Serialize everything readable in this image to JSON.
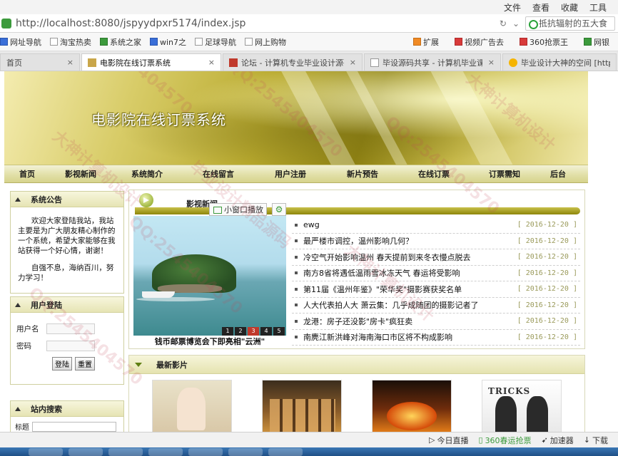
{
  "browser": {
    "menu": [
      "文件",
      "查看",
      "收藏",
      "工具"
    ],
    "url": "http://localhost:8080/jspyydpxr5174/index.jsp",
    "search_text": "抵抗辐射的五大食",
    "bookmarks": [
      "网址导航",
      "淘宝热卖",
      "系统之家",
      "win7之",
      "足球导航",
      "网上购物"
    ],
    "bookmarks_right": [
      "扩展",
      "视频广告去",
      "360抢票王",
      "网银"
    ],
    "tabs": [
      {
        "label": "首页",
        "active": false
      },
      {
        "label": "电影院在线订票系统",
        "active": true
      },
      {
        "label": "论坛 - 计算机专业毕业设计源码网",
        "active": false
      },
      {
        "label": "毕设源码共享 - 计算机毕业课程设计",
        "active": false
      },
      {
        "label": "毕业设计大神的空间 [http://",
        "active": false
      }
    ],
    "status": [
      "今日直播",
      "360春运抢票",
      "加速器",
      "下载"
    ]
  },
  "site": {
    "title": "电影院在线订票系统",
    "nav": [
      "首页",
      "影视新闻",
      "系统简介",
      "在线留言",
      "用户注册",
      "新片预告",
      "在线订票",
      "订票需知",
      "后台"
    ],
    "notice": {
      "heading": "系统公告",
      "para1": "欢迎大家登陆我站，我站主要是为广大朋友精心制作的一个系统，希望大家能够在我站获得一个好心情，谢谢！",
      "para2": "自强不息，海纳百川，努力学习！"
    },
    "login": {
      "heading": "用户登陆",
      "user_label": "用户名",
      "pass_label": "密码",
      "login_btn": "登陆",
      "reset_btn": "重置"
    },
    "search": {
      "heading": "站内搜索",
      "label": "标题"
    },
    "news": {
      "heading": "影视新闻",
      "popup_label": "小窗口播放",
      "photo_caption": "钱币邮票博览会下即亮相\"云洲\"",
      "pager": [
        "1",
        "2",
        "3",
        "4",
        "5"
      ],
      "active_page": "3",
      "items": [
        {
          "title": "ewg",
          "date": "[ 2016-12-20 ]"
        },
        {
          "title": "最严楼市调控，温州影响几何？",
          "date": "[ 2016-12-20 ]"
        },
        {
          "title": "冷空气开始影响温州 春天提前到来冬衣慢点脱去",
          "date": "[ 2016-12-20 ]"
        },
        {
          "title": "南方8省将遇低温雨雪冰冻天气 春运将受影响",
          "date": "[ 2016-12-20 ]"
        },
        {
          "title": "第11届《温州年鉴》\"荣华奖\"摄影赛获奖名单",
          "date": "[ 2016-12-20 ]"
        },
        {
          "title": "人大代表拍人大 萧云集：几乎成随团的摄影记者了",
          "date": "[ 2016-12-20 ]"
        },
        {
          "title": "龙港：房子还没影\"房卡\"疯狂卖",
          "date": "[ 2016-12-20 ]"
        },
        {
          "title": "南麂江新洪峰对海南海口市区将不构成影响",
          "date": "[ 2016-12-20 ]"
        }
      ]
    },
    "films": {
      "heading": "最新影片",
      "poster4_text": "TRICKS"
    }
  },
  "watermark": [
    "QQ:2545404570",
    "大神计算机设计",
    "毕业设计精品源码"
  ]
}
